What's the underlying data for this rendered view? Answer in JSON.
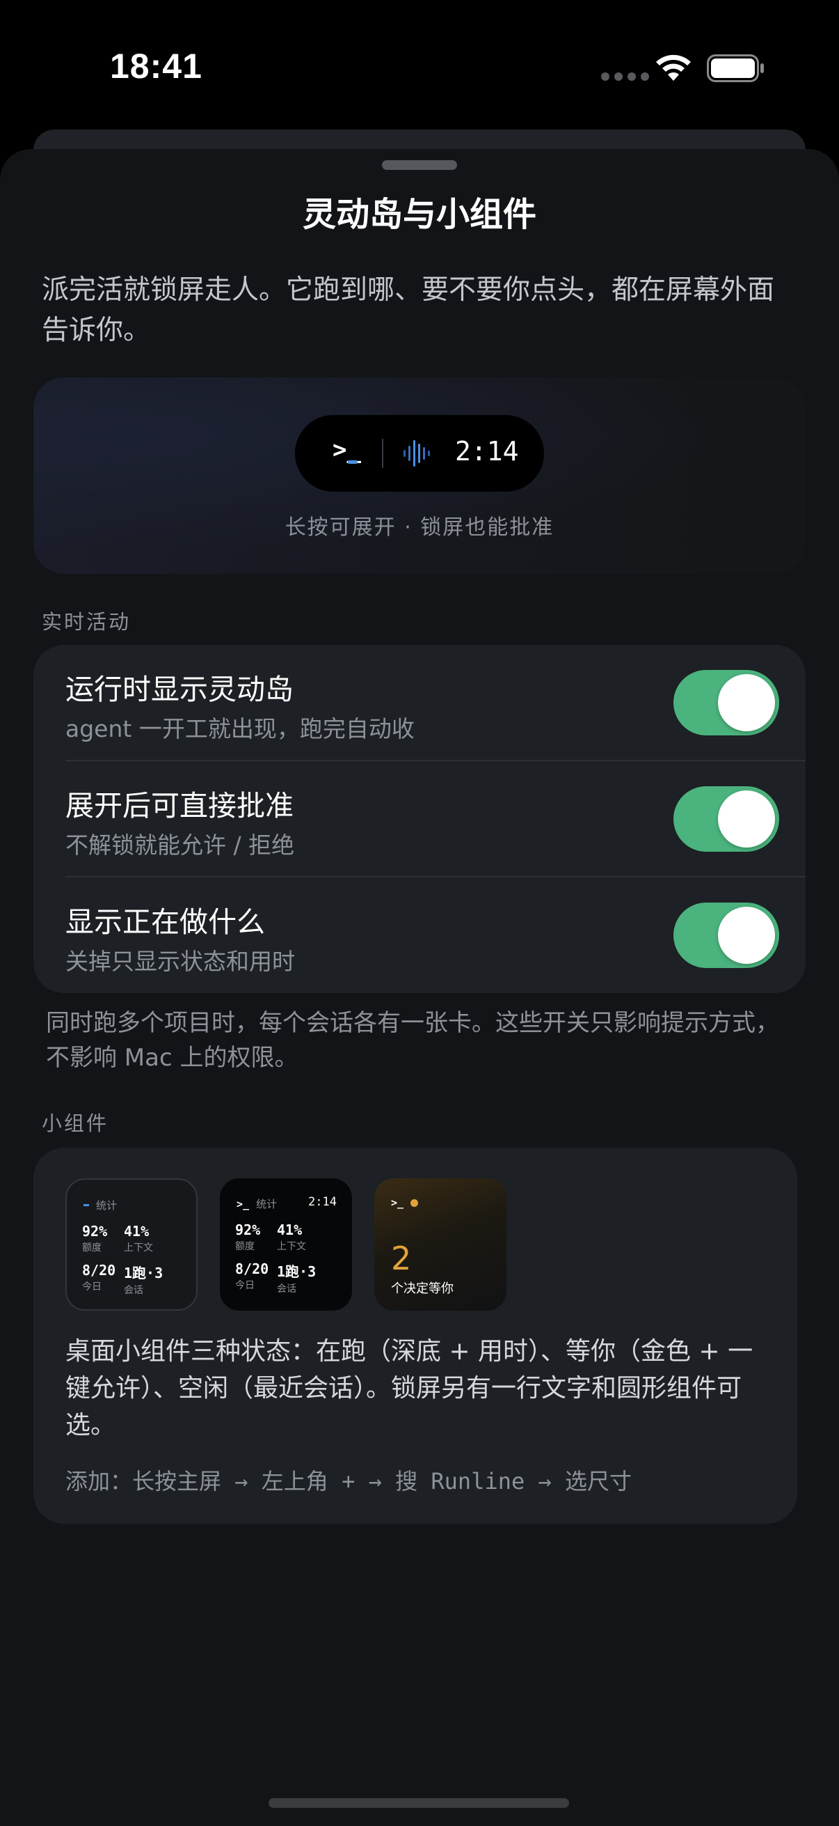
{
  "status_bar": {
    "time": "18:41"
  },
  "sheet": {
    "title": "灵动岛与小组件",
    "intro": "派完活就锁屏走人。它跑到哪、要不要你点头，都在屏幕外面告诉你。"
  },
  "hero": {
    "island_prompt": ">_",
    "island_time": "2:14",
    "caption": "长按可展开 · 锁屏也能批准"
  },
  "live_activity": {
    "section_label": "实时活动",
    "rows": [
      {
        "title": "运行时显示灵动岛",
        "subtitle": "agent 一开工就出现，跑完自动收",
        "on": true
      },
      {
        "title": "展开后可直接批准",
        "subtitle": "不解锁就能允许 / 拒绝",
        "on": true
      },
      {
        "title": "显示正在做什么",
        "subtitle": "关掉只显示状态和用时",
        "on": true
      }
    ],
    "footnote": "同时跑多个项目时，每个会话各有一张卡。这些开关只影响提示方式，不影响 Mac 上的权限。"
  },
  "widgets": {
    "section_label": "小组件",
    "w1": {
      "head": "统计",
      "cells": [
        {
          "value": "92%",
          "label": "额度"
        },
        {
          "value": "41%",
          "label": "上下文"
        },
        {
          "value": "8/20",
          "label": "今日"
        },
        {
          "value": "1跑·3",
          "label": "会话"
        }
      ]
    },
    "w2": {
      "prompt": ">_",
      "head": "统计",
      "time": "2:14",
      "cells": [
        {
          "value": "92%",
          "label": "额度"
        },
        {
          "value": "41%",
          "label": "上下文"
        },
        {
          "value": "8/20",
          "label": "今日"
        },
        {
          "value": "1跑·3",
          "label": "会话"
        }
      ]
    },
    "w3": {
      "prompt": ">_",
      "count": "2",
      "note": "个决定等你"
    },
    "description": "桌面小组件三种状态：在跑（深底 + 用时）、等你（金色 + 一键允许）、空闲（最近会话）。锁屏另有一行文字和圆形组件可选。",
    "howto": "添加：长按主屏 → 左上角 + → 搜 Runline → 选尺寸"
  },
  "colors": {
    "accent_green": "#4bb37d",
    "accent_gold": "#e0a33a",
    "accent_blue": "#4a90e2",
    "sheet_bg": "#121417",
    "card_bg": "#1d2024"
  }
}
